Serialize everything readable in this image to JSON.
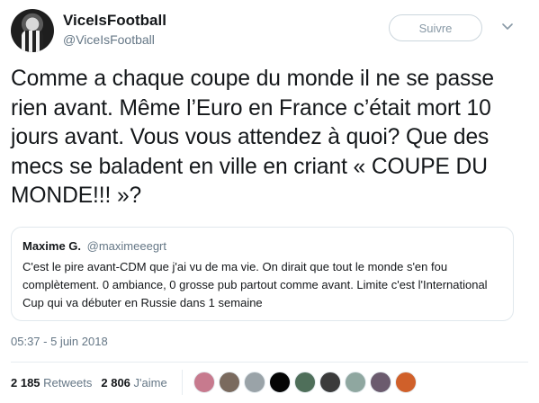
{
  "author": {
    "display_name": "ViceIsFootball",
    "handle": "@ViceIsFootball",
    "avatar_icon": "avatar-photo"
  },
  "actions": {
    "follow_label": "Suivre",
    "menu_icon": "chevron-down-icon"
  },
  "tweet": {
    "text": "Comme a chaque coupe du monde il ne se passe rien avant. Même l’Euro en France c’était mort 10 jours avant. Vous vous attendez à quoi? Que des mecs se baladent en ville en criant « COUPE DU MONDE!!! »?",
    "timestamp": "05:37 - 5 juin 2018"
  },
  "quoted_tweet": {
    "name": "Maxime G.",
    "handle": "@maximeeegrt",
    "text": "C'est le pire avant-CDM que j'ai vu de ma vie. On dirait que tout le monde s'en fou complètement. 0 ambiance, 0 grosse pub partout comme avant. Limite c'est l'International Cup qui va débuter en Russie dans 1 semaine"
  },
  "stats": {
    "retweets_count": "2 185",
    "retweets_label": "Retweets",
    "likes_count": "2 806",
    "likes_label": "J'aime"
  },
  "likers": [
    {
      "name": "liker-avatar-1",
      "color": "#c77a8e"
    },
    {
      "name": "liker-avatar-2",
      "color": "#7a6a5e"
    },
    {
      "name": "liker-avatar-3",
      "color": "#9aa3a8"
    },
    {
      "name": "liker-avatar-4",
      "color": "#050505"
    },
    {
      "name": "liker-avatar-5",
      "color": "#4f6f5a"
    },
    {
      "name": "liker-avatar-6",
      "color": "#3b3b3b"
    },
    {
      "name": "liker-avatar-7",
      "color": "#8fa7a0"
    },
    {
      "name": "liker-avatar-8",
      "color": "#6b5b6e"
    },
    {
      "name": "liker-avatar-9",
      "color": "#d0602a"
    }
  ],
  "colors": {
    "text": "#14171a",
    "secondary": "#657786",
    "border": "#e1e8ed"
  }
}
